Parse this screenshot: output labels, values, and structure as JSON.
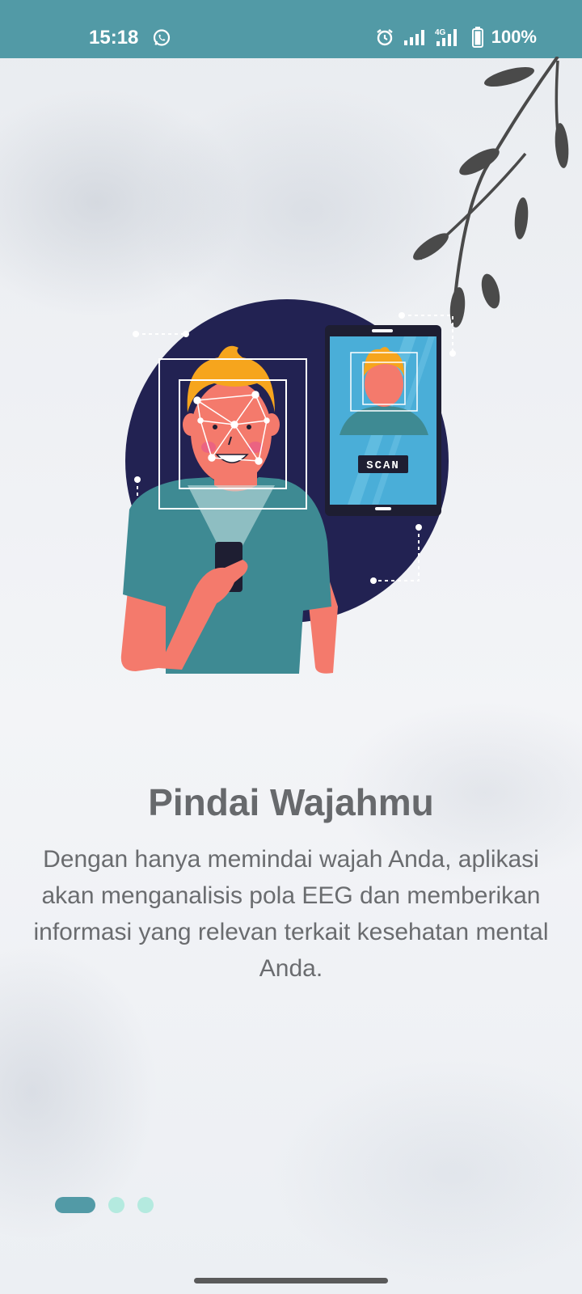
{
  "status_bar": {
    "time": "15:18",
    "battery": "100%",
    "network": "4G",
    "icons": [
      "whatsapp-icon",
      "alarm-icon",
      "signal-icon",
      "signal-4g-icon",
      "battery-icon"
    ],
    "background_color": "#529aa6"
  },
  "illustration": {
    "phone_screen_button": "SCAN"
  },
  "onboarding": {
    "title": "Pindai Wajahmu",
    "description": "Dengan hanya memindai wajah Anda, aplikasi akan menganalisis pola EEG dan memberikan informasi yang relevan terkait kesehatan mental Anda."
  },
  "pager": {
    "total_pages": 3,
    "current_page": 1,
    "active_color": "#529aa6",
    "inactive_color": "#b4eadf"
  }
}
